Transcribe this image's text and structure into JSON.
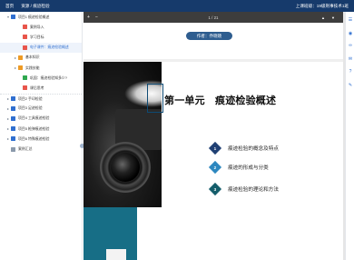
{
  "topbar": {
    "home": "首页",
    "path": "资源 / 痕迹检验",
    "user": "上课班级：19级刑事技术1班"
  },
  "sidebar": {
    "items": [
      {
        "label": "项目1 痕迹检验概述",
        "icon": "folder-icon",
        "color": "blue",
        "level": 0,
        "arrow": "▾",
        "active": false
      },
      {
        "label": "案例导入",
        "icon": "document-icon",
        "color": "red",
        "level": 2,
        "arrow": "",
        "active": false
      },
      {
        "label": "学习目标",
        "icon": "document-icon",
        "color": "red",
        "level": 2,
        "arrow": "",
        "active": false
      },
      {
        "label": "电子课件：痕迹检验概述",
        "icon": "document-icon",
        "color": "red",
        "level": 2,
        "arrow": "",
        "active": true
      },
      {
        "label": "基本知识",
        "icon": "folder-icon",
        "color": "orange",
        "level": 1,
        "arrow": "▸",
        "active": false
      },
      {
        "label": "实践技能",
        "icon": "folder-icon",
        "color": "orange",
        "level": 1,
        "arrow": "▸",
        "active": false
      },
      {
        "label": "巩固：痕迹检验知多少?",
        "icon": "check-icon",
        "color": "green",
        "level": 2,
        "arrow": "",
        "active": false
      },
      {
        "label": "课后思考",
        "icon": "document-icon",
        "color": "red",
        "level": 2,
        "arrow": "",
        "active": false
      },
      {
        "label": "项目2 手印检验",
        "icon": "folder-icon",
        "color": "blue",
        "level": 0,
        "arrow": "▸",
        "active": false
      },
      {
        "label": "项目3 足迹检验",
        "icon": "folder-icon",
        "color": "blue",
        "level": 0,
        "arrow": "▸",
        "active": false
      },
      {
        "label": "项目4 工具痕迹检验",
        "icon": "folder-icon",
        "color": "blue",
        "level": 0,
        "arrow": "▸",
        "active": false
      },
      {
        "label": "项目5 枪弹痕迹检验",
        "icon": "folder-icon",
        "color": "blue",
        "level": 0,
        "arrow": "▸",
        "active": false
      },
      {
        "label": "项目6 特殊痕迹检验",
        "icon": "folder-icon",
        "color": "blue",
        "level": 0,
        "arrow": "▸",
        "active": false
      },
      {
        "label": "案例汇总",
        "icon": "folder-icon",
        "color": "gray",
        "level": 0,
        "arrow": "",
        "active": false
      }
    ]
  },
  "viewer": {
    "zoom_in": "+",
    "zoom_out": "−",
    "page_indicator": "1 / 21",
    "prev": "▲",
    "next": "▼",
    "author_label": "作者：乔晓晓"
  },
  "slide": {
    "title": "第一单元　痕迹检验概述",
    "items": [
      {
        "num": "1",
        "text": "痕迹检验的概念及特点",
        "color": "#1f3f73"
      },
      {
        "num": "2",
        "text": "痕迹的形成与分类",
        "color": "#2d87bf"
      },
      {
        "num": "3",
        "text": "痕迹检验的理论和方法",
        "color": "#145d6b"
      }
    ]
  },
  "rightbar": {
    "icons": [
      "list-icon",
      "user-icon",
      "link-icon",
      "chat-icon",
      "question-icon",
      "edit-icon"
    ],
    "glyphs": [
      "☰",
      "◉",
      "∞",
      "✉",
      "?",
      "✎"
    ]
  }
}
